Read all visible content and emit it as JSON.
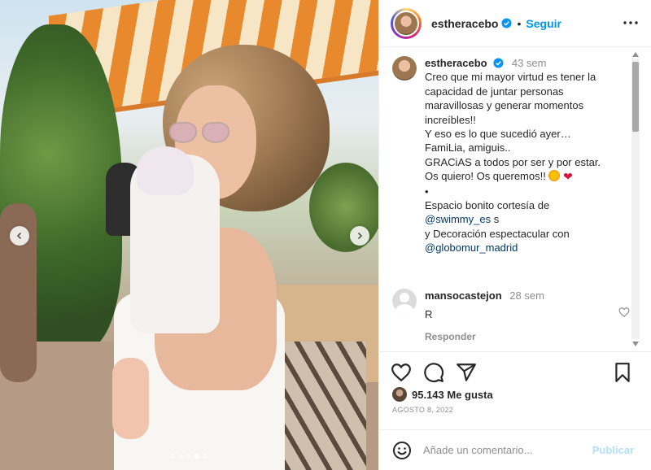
{
  "post": {
    "username": "estheracebo",
    "follow_label": "Seguir",
    "separator": "•"
  },
  "caption": {
    "username": "estheracebo",
    "time": "43 sem",
    "lines": [
      "Creo que mi mayor virtud es tener la",
      "capacidad de juntar personas",
      "maravillosas y generar momentos",
      "increíbles!!",
      "Y eso es lo que sucedió ayer…",
      "FamiLia, amiguis..",
      "GRACiAS a todos por ser y por estar.",
      "Os quiero! Os queremos!!",
      "•",
      "Espacio bonito cortesía de"
    ],
    "mention1": "@swimmy_es",
    "mention1_suffix": " s",
    "line_decoracion": "y Decoración espectacular con",
    "mention2": "@globomur_madrid"
  },
  "comment": {
    "username": "mansocastejon",
    "time": "28 sem",
    "text": "R",
    "reply_label": "Responder"
  },
  "stats": {
    "likes": "95.143 Me gusta",
    "date": "AGOSTO 8, 2022"
  },
  "add_comment": {
    "placeholder": "Añade un comentario...",
    "publish_label": "Publicar"
  },
  "carousel": {
    "dot_count": 5,
    "active_index": 3
  },
  "colors": {
    "accent": "#0095f6",
    "verified": "#0095f6",
    "publish_disabled": "#b2dffc",
    "muted": "#8e8e8e"
  },
  "icons": {
    "header_more": "more-horizontal-icon",
    "like": "heart-outline-icon",
    "comment": "comment-bubble-icon",
    "share": "paper-plane-icon",
    "save": "bookmark-icon",
    "emoji": "smiley-icon",
    "prev": "chevron-left-icon",
    "next": "chevron-right-icon"
  }
}
